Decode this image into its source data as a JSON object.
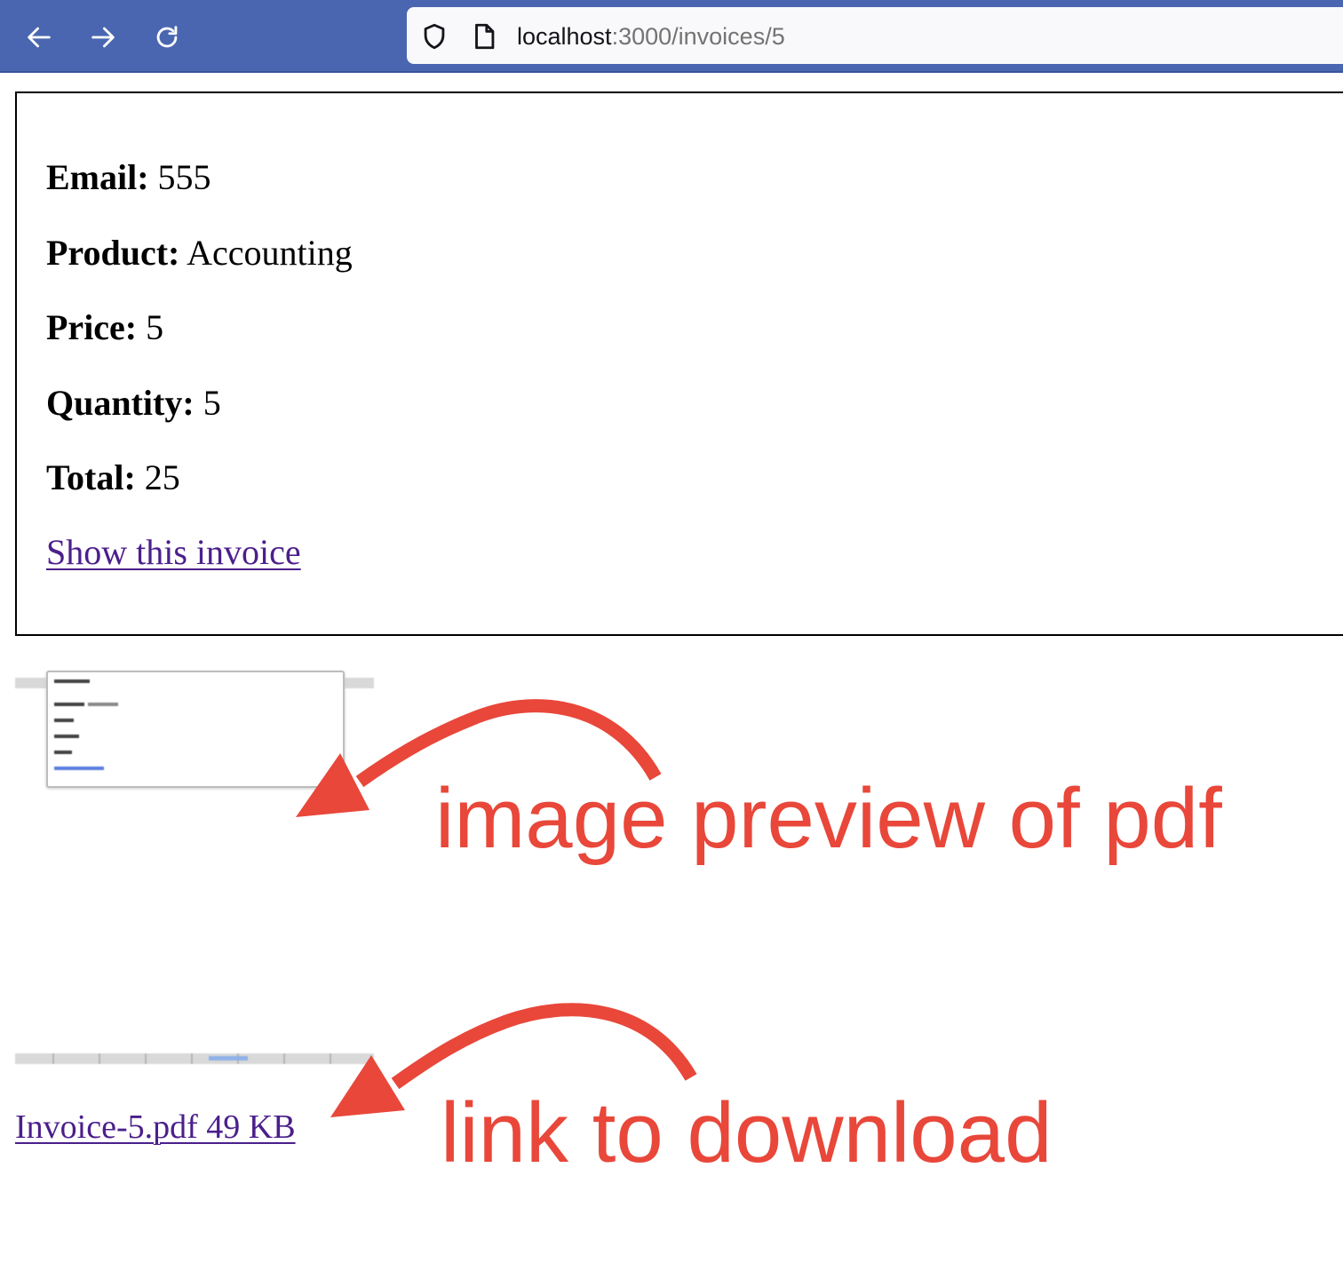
{
  "browser": {
    "url_host": "localhost",
    "url_path": ":3000/invoices/5",
    "icons": [
      "back-arrow-icon",
      "forward-arrow-icon",
      "reload-icon",
      "shield-icon",
      "page-icon"
    ],
    "toolbar_color": "#4a66b0"
  },
  "invoice": {
    "email_label": "Email:",
    "email_value": "555",
    "product_label": "Product:",
    "product_value": "Accounting",
    "price_label": "Price:",
    "price_value": "5",
    "quantity_label": "Quantity:",
    "quantity_value": "5",
    "total_label": "Total:",
    "total_value": "25",
    "show_link": "Show this invoice"
  },
  "attachment": {
    "download_link": "Invoice-5.pdf 49 KB"
  },
  "annotations": {
    "preview_label": "image preview of pdf",
    "download_label": "link to download",
    "color": "#e8473a"
  }
}
